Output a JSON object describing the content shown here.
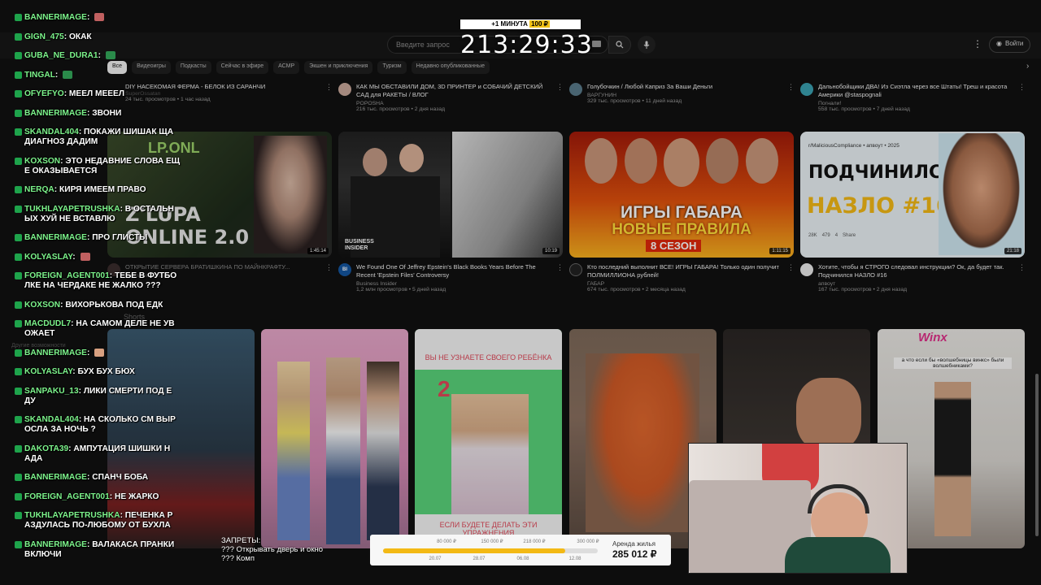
{
  "timer": {
    "bonus_label": "+1 МИНУТА",
    "bonus_amount": "100 ₽",
    "value": "213:29:33"
  },
  "header": {
    "search_placeholder": "Введите запрос",
    "signin_label": "Войти"
  },
  "chips": [
    "Все",
    "Видеоигры",
    "Подкасты",
    "Сейчас в эфире",
    "АСМР",
    "Экшен и приключения",
    "Туризм",
    "Недавно опубликованные"
  ],
  "row1": [
    {
      "title": "DIY НАСЕКОМАЯ ФЕРМА - БЕЛОК ИЗ САРАНЧИ",
      "channel": "SuperOssatan",
      "stats": "24 тыс. просмотров • 1 час назад"
    },
    {
      "title": "КАК МЫ ОБСТАВИЛИ ДОМ, 3D ПРИНТЕР и СОБАЧИЙ ДЕТСКИЙ САД для РАКЕТЫ / ВЛОГ",
      "channel": "POPOSHA",
      "stats": "216 тыс. просмотров • 2 дня назад"
    },
    {
      "title": "Голубочкин / Любой Каприз За Ваши Деньги",
      "channel": "ВАРГУНИН",
      "stats": "329 тыс. просмотров • 11 дней назад"
    },
    {
      "title": "Дальнобойщики ДВА! Из Сиэтла через все Штаты! Треш и красота Америки @staspognali",
      "channel": "Погнали!",
      "stats": "558 тыс. просмотров • 7 дней назад"
    }
  ],
  "row2": [
    {
      "title": "ОТКРЫТИЕ СЕРВЕРА БРАТИШКИНА ПО МАЙНКРАФТУ...",
      "channel": "Братишкин Нова",
      "stats": "",
      "duration": "1:45:14",
      "thumb_text_1": "Z'LUPA",
      "thumb_text_2": "ONLINE 2.0",
      "thumb_text_3": "LP.ONL"
    },
    {
      "title": "We Found One Of Jeffrey Epstein's Black Books Years Before The Recent 'Epstein Files' Controversy",
      "channel": "Business Insider",
      "stats": "1,2 млн просмотров • 5 дней назад",
      "duration": "10:19",
      "thumb_text_1": "BUSINESS",
      "thumb_text_2": "INSIDER",
      "avatar_text": "BI"
    },
    {
      "title": "Кто последний выполнит ВСЕ! ИГРЫ ГАБАРА! Только один получит ПОЛМИЛЛИОНА рублей!",
      "channel": "ГАБАР",
      "stats": "674 тыс. просмотров • 2 месяца назад",
      "duration": "1:11:15",
      "thumb_text_1": "ИГРЫ ГАБАРА",
      "thumb_text_2": "НОВЫЕ ПРАВИЛА",
      "thumb_text_3": "8 СЕЗОН"
    },
    {
      "title": "Хотите, чтобы я СТРОГО следовал инструкции? Ок, да будет так. Подчинился НАЗЛО #16",
      "channel": "апвоут",
      "stats": "167 тыс. просмотров • 2 дня назад",
      "duration": "21:18",
      "thumb_text_1": "ПОДЧИНИЛСЯ",
      "thumb_text_2": "НАЗЛО #16",
      "thumb_sub": "r/MaliciousCompliance • апвоут • 2025",
      "likes": "28K",
      "comments": "479",
      "shares": "4",
      "share_label": "Share"
    }
  ],
  "side_labels": {
    "shorts": "Shorts",
    "other": "Другие возможности"
  },
  "shorts": [
    {
      "caption": ""
    },
    {
      "caption": ""
    },
    {
      "caption": "ВЫ НЕ УЗНАЕТЕ СВОЕГО РЕБЁНКА",
      "number": "2",
      "bottom": "ЕСЛИ БУДЕТЕ ДЕЛАТЬ ЭТИ УПРАЖНЕНИЯ"
    },
    {
      "caption": ""
    },
    {
      "caption": ""
    },
    {
      "caption": "а что если бы «волшебницы винкс» были волшебниками?",
      "logo": "Winx"
    }
  ],
  "chat": [
    {
      "user": "BANNERIMAGE",
      "text": "",
      "emote": "#c06060"
    },
    {
      "user": "GIGN_475",
      "text": "ОКАК"
    },
    {
      "user": "GUBA_NE_DURA1",
      "text": "",
      "emote": "#2a8a4a"
    },
    {
      "user": "TINGAL",
      "text": "",
      "emote": "#2a8a4a"
    },
    {
      "user": "OFYEFYO",
      "text": "МЕЕЛ МЕЕЕЛ"
    },
    {
      "user": "BANNERIMAGE",
      "text": "ЗВОНИ"
    },
    {
      "user": "SKANDAL404",
      "text": "ПОКАЖИ ШИШАК ЩА ДИАГНОЗ ДАДИМ"
    },
    {
      "user": "KOXSON",
      "text": "ЭТО НЕДАВНИЕ СЛОВА ЕЩ Е ОКАЗЫВАЕТСЯ"
    },
    {
      "user": "NERQA",
      "text": "КИРЯ ИМЕЕМ ПРАВО"
    },
    {
      "user": "TUKHLAYAPETRUSHKA",
      "text": "В ОСТАЛЬН ЫХ ХУЙ НЕ ВСТАВЛЮ"
    },
    {
      "user": "BANNERIMAGE",
      "text": "ПРО ГЛИСТЫ"
    },
    {
      "user": "KOLYASLAY",
      "text": "",
      "emote": "#c06060"
    },
    {
      "user": "FOREIGN_AGENT001",
      "text": "ТЕБЕ В ФУТБО ЛКЕ НА ЧЕРДАКЕ НЕ ЖАЛКО ???"
    },
    {
      "user": "KOXSON",
      "text": "ВИХОРЬКОВА ПОД ЕДК"
    },
    {
      "user": "MACDUDL7",
      "text": "НА САМОМ ДЕЛЕ НЕ УВ ОЖАЕТ"
    },
    {
      "user": "BANNERIMAGE",
      "text": "",
      "emote": "#d8a080"
    },
    {
      "user": "KOLYASLAY",
      "text": "БУХ БУХ БЮХ"
    },
    {
      "user": "SANPAKU_13",
      "text": "ЛИКИ СМЕРТИ ПОД Е ДУ"
    },
    {
      "user": "SKANDAL404",
      "text": "НА СКОЛЬКО СМ ВЫР ОСЛА ЗА НОЧЬ ?"
    },
    {
      "user": "DAKOTA39",
      "text": "АМПУТАЦИЯ ШИШКИ Н АДА"
    },
    {
      "user": "BANNERIMAGE",
      "text": "СПАНЧ БОБА"
    },
    {
      "user": "FOREIGN_AGENT001",
      "text": "НЕ ЖАРКО"
    },
    {
      "user": "TUKHLAYAPETRUSHKA",
      "text": "ПЕЧЕНКА Р АЗДУЛАСЬ ПО-ЛЮБОМУ ОТ БУХЛА"
    },
    {
      "user": "BANNERIMAGE",
      "text": "ВАЛАКАСА ПРАНКИ ВКЛЮЧИ"
    }
  ],
  "bans": {
    "title": "ЗАПРЕТЫ:",
    "items": [
      "??? Открывать дверь и окно",
      "??? Комп"
    ]
  },
  "rent": {
    "label": "Аренда жилья",
    "value": "285 012 ₽",
    "progress": 0.85,
    "top_ticks": [
      "80 000 ₽",
      "150 000 ₽",
      "218 000 ₽",
      "300 000 ₽"
    ],
    "bottom_ticks": [
      "20.07",
      "28.07",
      "06.08",
      "12.08"
    ]
  },
  "colors": {
    "accent": "#f3c316",
    "chat_user": "#7cf38b",
    "chat_badge": "#1ea34b"
  }
}
